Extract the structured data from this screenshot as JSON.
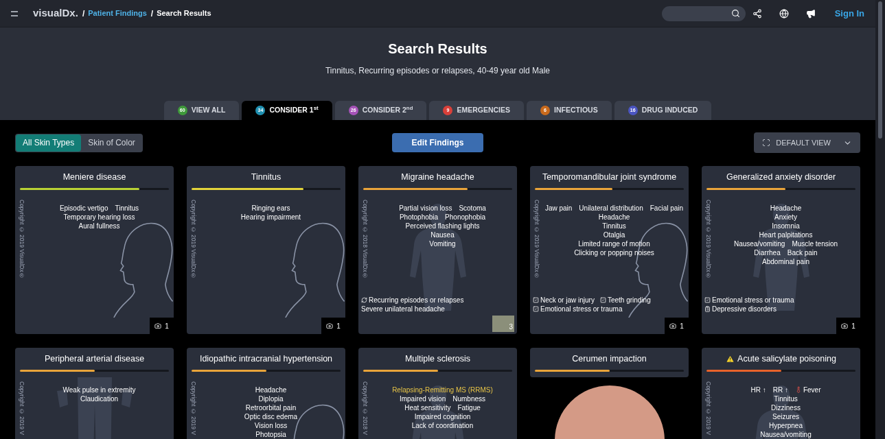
{
  "header": {
    "logo": "visualDx.",
    "breadcrumb": [
      {
        "sep": "/",
        "text": "Patient Findings",
        "link": true
      },
      {
        "sep": "/",
        "text": "Search Results",
        "link": false
      }
    ],
    "sign_in": "Sign In"
  },
  "title": "Search Results",
  "subtitle": "Tinnitus, Recurring episodes or relapses, 40-49 year old Male",
  "tabs": [
    {
      "count": "60",
      "label": "VIEW ALL",
      "color": "#3f9a3a",
      "selected": false
    },
    {
      "count": "34",
      "label": "CONSIDER 1$^{st}$",
      "color": "#1f8fb0",
      "selected": true
    },
    {
      "count": "26",
      "label": "CONSIDER 2$^{nd}$",
      "color": "#a653b8",
      "selected": false
    },
    {
      "count": "9",
      "label": "EMERGENCIES",
      "color": "#d9403a",
      "selected": false
    },
    {
      "count": "6",
      "label": "INFECTIOUS",
      "color": "#c96a1c",
      "selected": false
    },
    {
      "count": "16",
      "label": "DRUG INDUCED",
      "color": "#4b55c2",
      "selected": false
    }
  ],
  "skin_types": [
    {
      "label": "All Skin Types",
      "selected": true
    },
    {
      "label": "Skin of Color",
      "selected": false
    }
  ],
  "edit_button": "Edit Findings",
  "view_menu": "DEFAULT VIEW",
  "cards": [
    {
      "title": "Meniere disease",
      "color": "#b9d234",
      "level": 0.8,
      "warning": false,
      "kind": "head",
      "copyright": "Copyright © 2019 VisualDx®",
      "lines": [
        [
          "Episodic vertigo",
          "Tinnitus"
        ],
        [
          "Temporary hearing loss"
        ],
        [
          "Aural fullness"
        ]
      ],
      "media": {
        "kind": "camera",
        "count": "1"
      }
    },
    {
      "title": "Tinnitus",
      "color": "#e3d43a",
      "level": 0.75,
      "warning": false,
      "kind": "head",
      "copyright": "Copyright © 2019 VisualDx®",
      "lines": [
        [
          "Ringing ears"
        ],
        [
          "Hearing impairment"
        ]
      ],
      "media": {
        "kind": "camera",
        "count": "1"
      }
    },
    {
      "title": "Migraine headache",
      "color": "#e9a43a",
      "level": 0.7,
      "warning": false,
      "kind": "body",
      "copyright": "Copyright © 2018 VisualDx®",
      "lines": [
        [
          "Partial vision loss",
          "Scotoma"
        ],
        [
          "Photophobia",
          "Phonophobia"
        ],
        [
          "Perceived flashing lights"
        ],
        [
          "Nausea"
        ],
        [
          "Vomiting"
        ]
      ],
      "factors": [
        {
          "kind": "recurring",
          "text": "Recurring episodes or relapses"
        },
        {
          "kind": "plain",
          "text": "Severe unilateral headache"
        }
      ],
      "media": {
        "kind": "thumbnail",
        "count": "3"
      }
    },
    {
      "title": "Temporomandibular joint syndrome",
      "color": "#e9a43a",
      "level": 0.52,
      "warning": false,
      "kind": "head",
      "copyright": "Copyright © 2019 VisualDx®",
      "lines": [
        [
          "Jaw pain",
          "Unilateral distribution",
          "Facial pain"
        ],
        [
          "Headache"
        ],
        [
          "Tinnitus"
        ],
        [
          "Otalgia"
        ],
        [
          "Limited range of motion"
        ],
        [
          "Clicking or popping noises"
        ]
      ],
      "factors": [
        {
          "kind": "trigger",
          "text": "Neck or jaw injury"
        },
        {
          "kind": "trigger",
          "text": "Teeth grinding"
        },
        {
          "kind": "trigger",
          "text": "Emotional stress or trauma"
        }
      ],
      "media": {
        "kind": "camera",
        "count": "1"
      }
    },
    {
      "title": "Generalized anxiety disorder",
      "color": "#e9a43a",
      "level": 0.53,
      "warning": false,
      "kind": "body",
      "copyright": "Copyright © 2019 VisualDx®",
      "lines": [
        [
          "Headache"
        ],
        [
          "Anxiety"
        ],
        [
          "Insomnia"
        ],
        [
          "Heart palpitations"
        ],
        [
          "Nausea/vomiting",
          "Muscle tension"
        ],
        [
          "Diarrhea",
          "Back pain"
        ],
        [
          "Abdominal pain"
        ]
      ],
      "factors": [
        {
          "kind": "trigger",
          "text": "Emotional stress or trauma"
        },
        {
          "kind": "history",
          "text": "Depressive disorders"
        }
      ],
      "media": {
        "kind": "camera",
        "count": "1"
      }
    },
    {
      "title": "Peripheral arterial disease",
      "color": "#e9a43a",
      "level": 0.5,
      "warning": false,
      "kind": "legs",
      "copyright": "Copyright © 2019 V",
      "lines": [
        [
          "Weak pulse in extremity"
        ],
        [
          "Claudication"
        ]
      ]
    },
    {
      "title": "Idiopathic intracranial hypertension",
      "color": "#e9a43a",
      "level": 0.5,
      "warning": false,
      "kind": "head",
      "copyright": "Copyright © 2019 V",
      "lines": [
        [
          "Headache"
        ],
        [
          "Diplopia"
        ],
        [
          "Retroorbital pain"
        ],
        [
          "Optic disc edema"
        ],
        [
          "Vision loss"
        ],
        [
          "Photopsia"
        ]
      ]
    },
    {
      "title": "Multiple sclerosis",
      "color": "#e9a43a",
      "level": 0.5,
      "warning": false,
      "kind": "body",
      "copyright": "Copyright © 2018 V",
      "heading": "Relapsing-Remitting MS (RRMS)",
      "lines": [
        [
          "Impaired vision",
          "Numbness"
        ],
        [
          "Heat sensitivity",
          "Fatigue"
        ],
        [
          "Impaired cognition"
        ],
        [
          "Lack of coordination"
        ]
      ]
    },
    {
      "title": "Cerumen impaction",
      "color": "#e9a43a",
      "level": 0.5,
      "warning": false,
      "kind": "photo"
    },
    {
      "title": "Acute salicylate poisoning",
      "color": "#e8622a",
      "level": 0.5,
      "warning": true,
      "kind": "body",
      "copyright": "Copyright © 2019 V",
      "lines": [
        [
          "HR ↑",
          "RR ↑",
          {
            "kind": "fever",
            "text": "Fever"
          }
        ],
        [
          "Tinnitus"
        ],
        [
          "Dizziness"
        ],
        [
          "Seizures"
        ],
        [
          "Hyperpnea"
        ],
        [
          "Nausea/vomiting"
        ]
      ]
    }
  ]
}
